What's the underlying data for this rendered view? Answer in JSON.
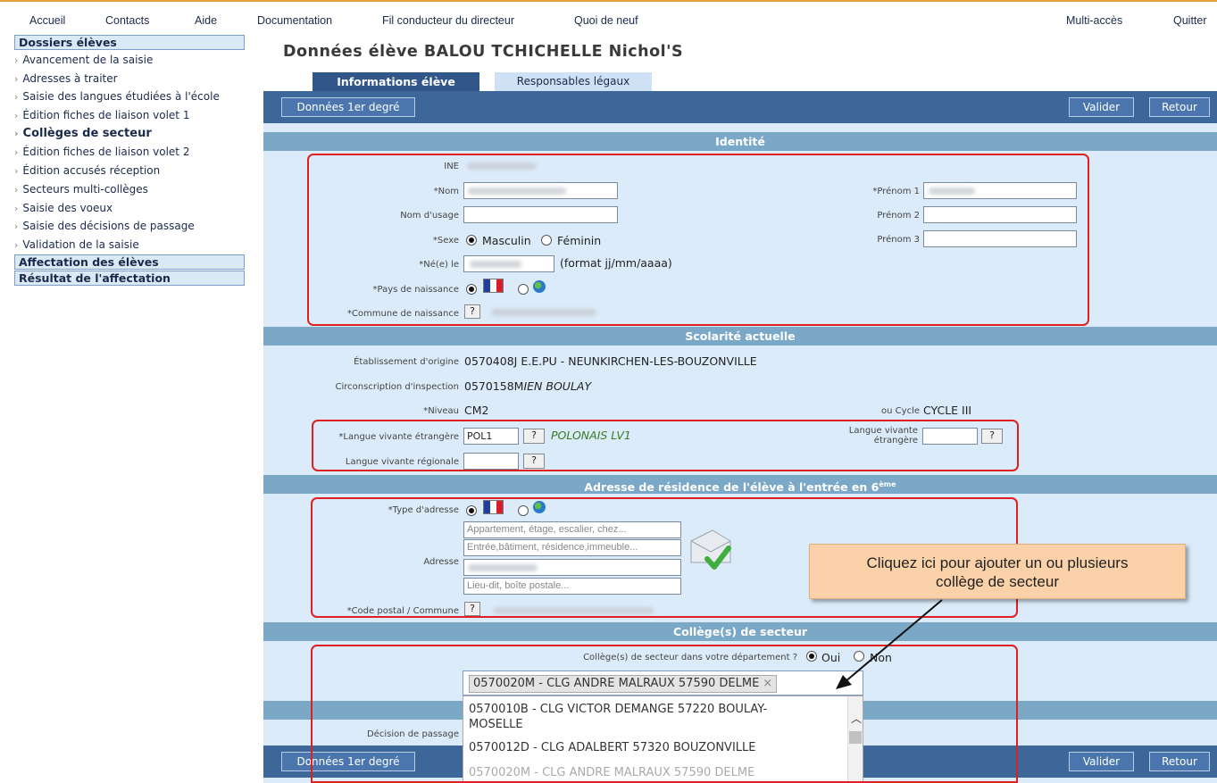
{
  "topmenu": {
    "accueil": "Accueil",
    "contacts": "Contacts",
    "aide": "Aide",
    "documentation": "Documentation",
    "fil": "Fil conducteur du directeur",
    "quoi": "Quoi de neuf",
    "multi": "Multi-accès",
    "quitter": "Quitter"
  },
  "sidebar": {
    "section1": "Dossiers élèves",
    "items": [
      "Avancement de la saisie",
      "Adresses à traiter",
      "Saisie des langues étudiées à l'école",
      "Édition fiches de liaison volet 1",
      "Collèges de secteur",
      "Édition fiches de liaison volet 2",
      "Édition accusés réception",
      "Secteurs multi-collèges",
      "Saisie des voeux",
      "Saisie des décisions de passage",
      "Validation de la saisie"
    ],
    "section2": "Affectation des élèves",
    "section3": "Résultat de l'affectation"
  },
  "page": {
    "title": "Données élève BALOU TCHICHELLE Nichol'S"
  },
  "tabs": {
    "active": "Informations élève",
    "inactive": "Responsables légaux"
  },
  "buttons": {
    "donnees": "Données 1er degré",
    "valider": "Valider",
    "retour": "Retour"
  },
  "identite": {
    "header": "Identité",
    "ine": "INE",
    "nom": "*Nom",
    "nom_usage": "Nom d'usage",
    "sexe": "*Sexe",
    "masculin": "Masculin",
    "feminin": "Féminin",
    "ne_le": "*Né(e) le",
    "format": "(format jj/mm/aaaa)",
    "pays": "*Pays de naissance",
    "commune": "*Commune de naissance",
    "prenom1": "*Prénom 1",
    "prenom2": "Prénom 2",
    "prenom3": "Prénom 3",
    "q": "?"
  },
  "scolarite": {
    "header": "Scolarité actuelle",
    "etab_label": "Établissement d'origine",
    "etab_val": "0570408J E.E.PU - NEUNKIRCHEN-LES-BOUZONVILLE",
    "circ_label": "Circonscription d'inspection",
    "circ_code": "0570158M",
    "circ_name": "IEN BOULAY",
    "niveau_label": "*Niveau",
    "niveau_val": "CM2",
    "cycle_label": "ou Cycle",
    "cycle_val": "CYCLE III",
    "lve_label": "*Langue vivante étrangère",
    "lve_val": "POL1",
    "lve_name": "POLONAIS LV1",
    "lve2_label1": "Langue vivante",
    "lve2_label2": "étrangère",
    "lvr_label": "Langue vivante régionale"
  },
  "adresse": {
    "header_main": "Adresse de résidence de l'élève à l'entrée en 6",
    "header_sup": "ème",
    "type_label": "*Type d'adresse",
    "adresse_label": "Adresse",
    "ph1": "Appartement, étage, escalier, chez...",
    "ph2": "Entrée,bâtiment, résidence,immeuble...",
    "ph4": "Lieu-dit, boîte postale...",
    "cp_label": "*Code postal / Commune"
  },
  "college": {
    "header": "Collège(s) de secteur",
    "question": "Collège(s) de secteur dans votre département ?",
    "oui": "Oui",
    "non": "Non",
    "selected": "0570020M - CLG ANDRE MALRAUX 57590 DELME",
    "remove": "×",
    "options": [
      "0570010B - CLG VICTOR DEMANGE 57220 BOULAY-",
      "MOSELLE",
      "0570012D - CLG ADALBERT 57320 BOUZONVILLE",
      "0570020M - CLG ANDRE MALRAUX 57590 DELME"
    ],
    "decision_label": "Décision de passage"
  },
  "callout": {
    "line1": "Cliquez ici pour ajouter un ou plusieurs",
    "line2": "collège de secteur"
  },
  "colors": {
    "bluebar": "#3d6699",
    "section_header": "#7ca8c7",
    "content_bg": "#dcebfa",
    "highlight": "#e02020",
    "callout_bg": "#fbd1a9"
  }
}
